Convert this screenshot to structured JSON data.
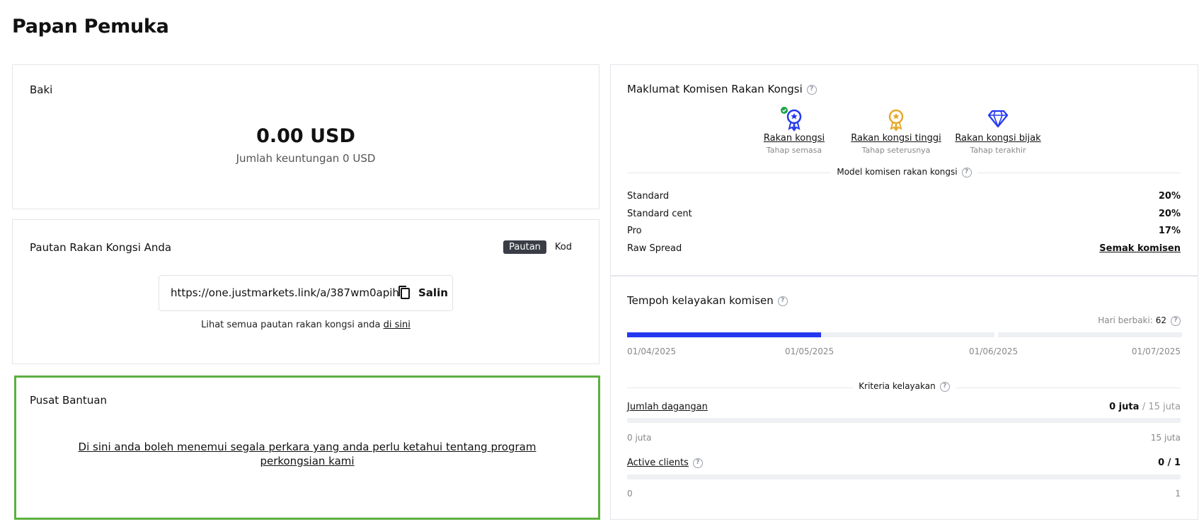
{
  "page": {
    "title": "Papan Pemuka"
  },
  "balance": {
    "title": "Baki",
    "amount": "0.00 USD",
    "profit": "Jumlah keuntungan 0 USD"
  },
  "partner_link": {
    "title": "Pautan Rakan Kongsi Anda",
    "tabs": [
      "Pautan",
      "Kod"
    ],
    "active_tab": "Pautan",
    "url": "https://one.justmarkets.link/a/387wm0apih",
    "copy_label": "Salin",
    "note_prefix": "Lihat semua pautan rakan kongsi anda ",
    "note_link": "di sini"
  },
  "help_center": {
    "title": "Pusat Bantuan",
    "text": "Di sini anda boleh menemui segala perkara yang anda perlu ketahui tentang program perkongsian kami"
  },
  "commission": {
    "title": "Maklumat Komisen Rakan Kongsi",
    "stages": [
      {
        "name": "Rakan kongsi",
        "sub": "Tahap semasa",
        "icon": "medal-blue-icon",
        "color": "#2438f0"
      },
      {
        "name": "Rakan kongsi tinggi",
        "sub": "Tahap seterusnya",
        "icon": "medal-gold-icon",
        "color": "#e7a92b"
      },
      {
        "name": "Rakan kongsi bijak",
        "sub": "Tahap terakhir",
        "icon": "diamond-icon",
        "color": "#2438f0"
      }
    ],
    "model_label": "Model komisen rakan kongsi",
    "rates": [
      {
        "label": "Standard",
        "value": "20%"
      },
      {
        "label": "Standard cent",
        "value": "20%"
      },
      {
        "label": "Pro",
        "value": "17%"
      },
      {
        "label": "Raw Spread",
        "value": "Semak komisen"
      }
    ]
  },
  "period": {
    "title": "Tempoh kelayakan komisen",
    "days_left_label": "Hari berbaki:",
    "days_left_value": "62",
    "progress": 0.35,
    "dates": [
      "01/04/2025",
      "01/05/2025",
      "01/06/2025",
      "01/07/2025"
    ],
    "criteria_label": "Kriteria kelayakan",
    "metrics": [
      {
        "name": "Jumlah dagangan",
        "current": "0 juta",
        "target": "/ 15 juta",
        "min": "0 juta",
        "max": "15 juta",
        "has_help": false
      },
      {
        "name": "Active clients",
        "current": "0",
        "target": "/ 1",
        "min": "0",
        "max": "1",
        "has_help": true
      }
    ]
  },
  "colors": {
    "accent": "#2438f0",
    "gold": "#e7a92b",
    "success": "#1aa34a",
    "highlight_border": "#5cb03f"
  }
}
